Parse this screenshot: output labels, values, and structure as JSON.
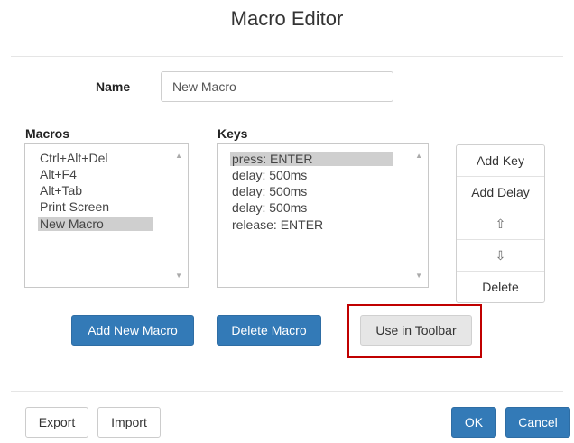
{
  "dialog": {
    "title": "Macro Editor"
  },
  "name_field": {
    "label": "Name",
    "value": "New Macro"
  },
  "macros": {
    "label": "Macros",
    "items": [
      "Ctrl+Alt+Del",
      "Alt+F4",
      "Alt+Tab",
      "Print Screen",
      "New Macro"
    ],
    "selected": "New Macro"
  },
  "keys": {
    "label": "Keys",
    "items": [
      "press: ENTER",
      "delay: 500ms",
      "delay: 500ms",
      "delay: 500ms",
      "release: ENTER"
    ],
    "selected": "press: ENTER"
  },
  "key_buttons": {
    "add_key": "Add Key",
    "add_delay": "Add Delay",
    "move_up": "⇧",
    "move_down": "⇩",
    "delete": "Delete"
  },
  "actions": {
    "add_new_macro": "Add New Macro",
    "delete_macro": "Delete Macro",
    "use_in_toolbar": "Use in Toolbar"
  },
  "footer": {
    "export": "Export",
    "import": "Import",
    "ok": "OK",
    "cancel": "Cancel"
  },
  "colors": {
    "primary": "#337ab7",
    "highlight": "#c00000",
    "selection": "#cfcfcf"
  }
}
